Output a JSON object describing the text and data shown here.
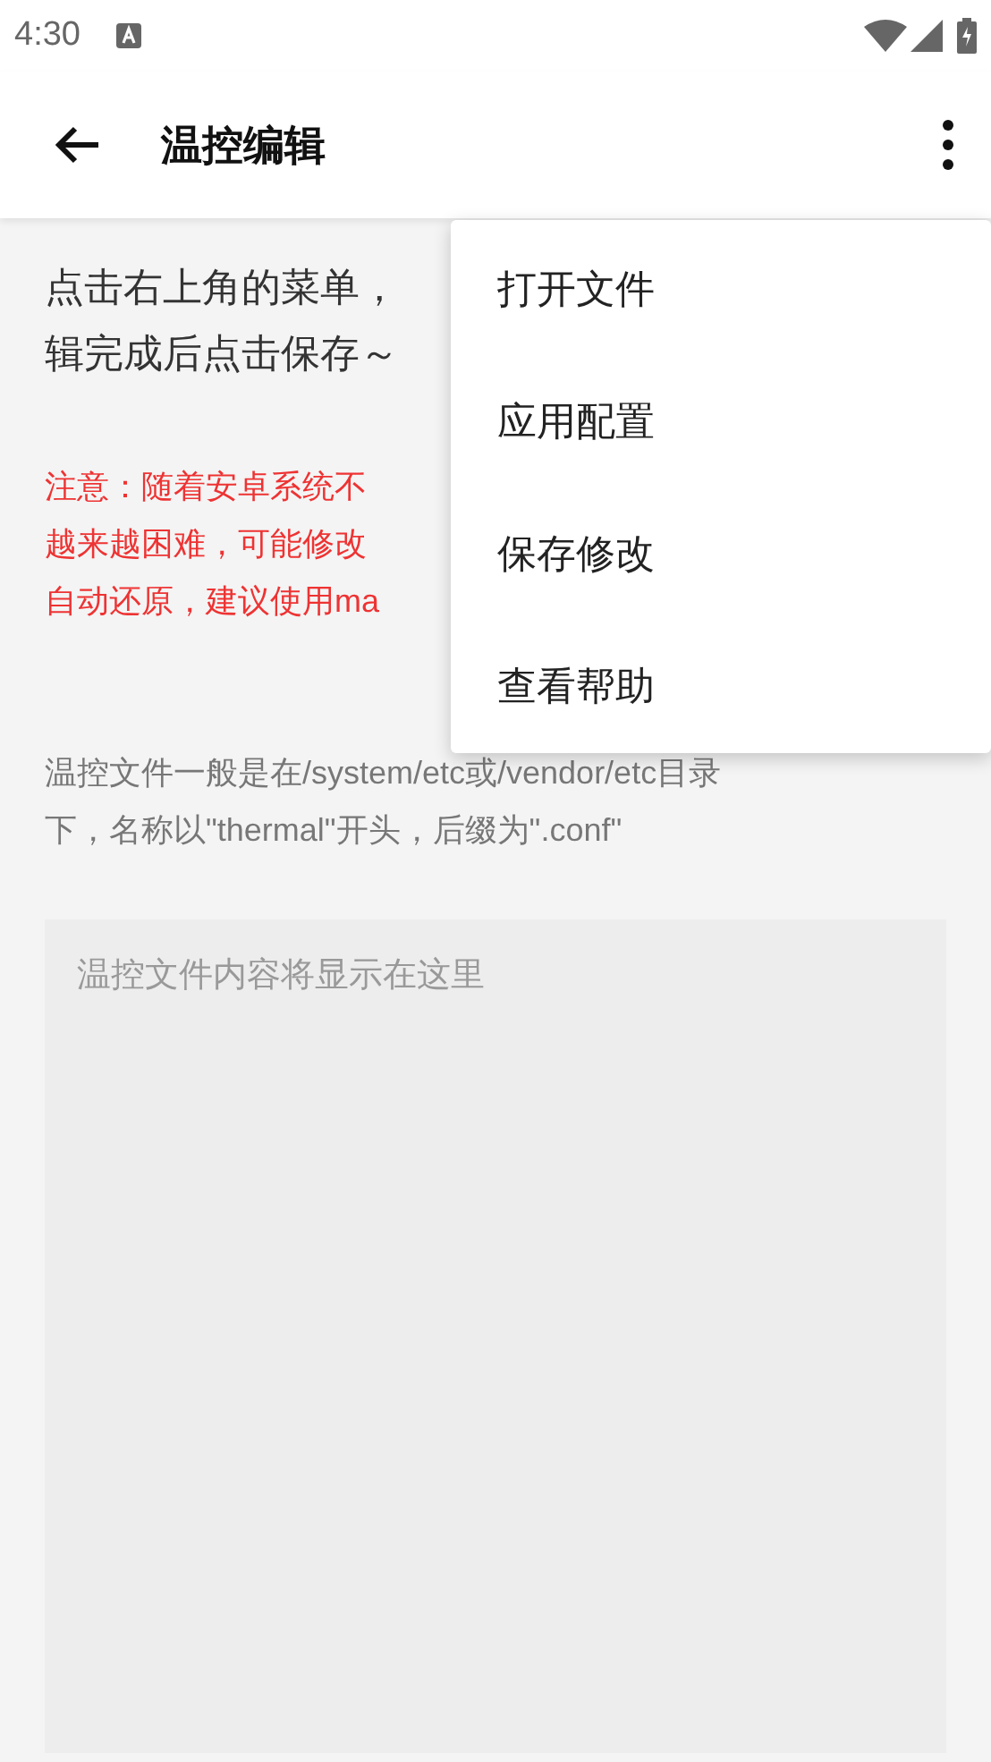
{
  "status_bar": {
    "time": "4:30"
  },
  "app_bar": {
    "title": "温控编辑"
  },
  "intro_lines": [
    "点击右上角的菜单，",
    "辑完成后点击保存～"
  ],
  "warning_lines": [
    "注意：随着安卓系统不",
    "越来越困难，可能修改",
    "自动还原，建议使用ma"
  ],
  "hint_lines": [
    "温控文件一般是在/system/etc或/vendor/etc目录",
    "下，名称以\"thermal\"开头，后缀为\".conf\""
  ],
  "editor": {
    "placeholder": "温控文件内容将显示在这里"
  },
  "menu": {
    "items": [
      "打开文件",
      "应用配置",
      "保存修改",
      "查看帮助"
    ]
  }
}
